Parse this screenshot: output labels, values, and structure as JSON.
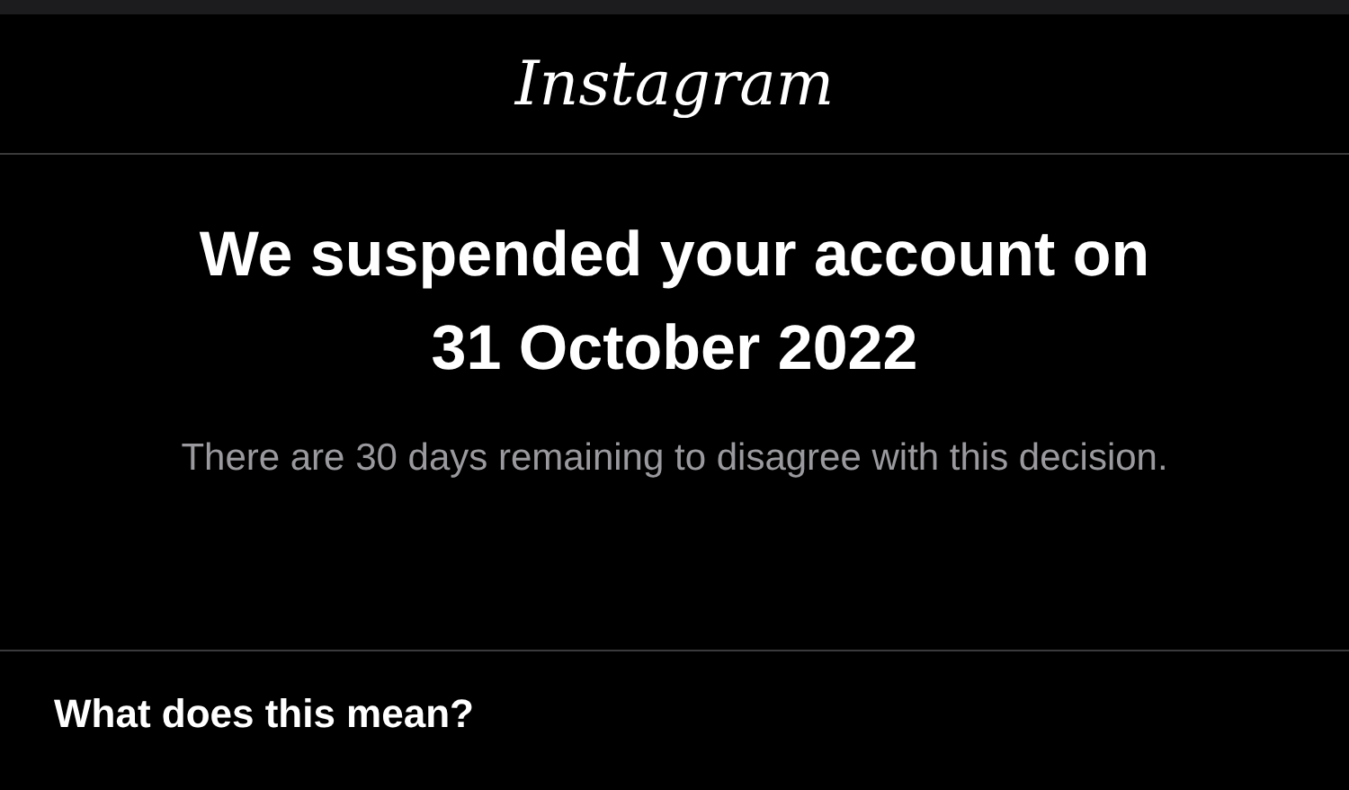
{
  "header": {
    "logo": "Instagram"
  },
  "notice": {
    "title": "We suspended your account on 31 October 2022",
    "message": "There are 30 days remaining to disagree with this decision."
  },
  "section": {
    "heading": "What does this mean?"
  }
}
